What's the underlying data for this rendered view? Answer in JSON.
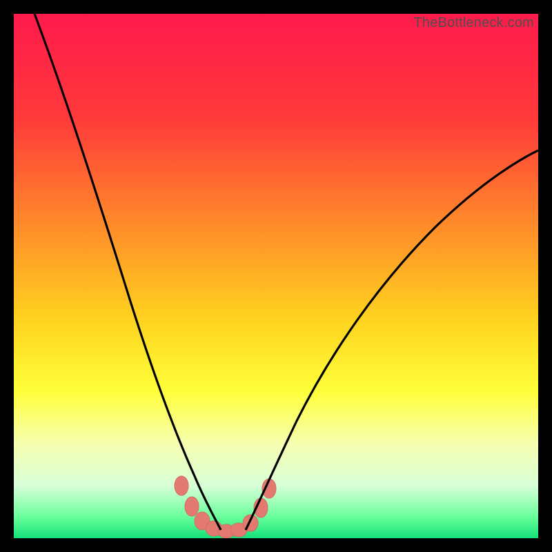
{
  "watermark": "TheBottleneck.com",
  "chart_data": {
    "type": "line",
    "title": "",
    "xlabel": "",
    "ylabel": "",
    "xlim": [
      0,
      100
    ],
    "ylim": [
      0,
      100
    ],
    "series": [
      {
        "name": "left-curve",
        "x": [
          4,
          8,
          12,
          16,
          20,
          24,
          27,
          29,
          31,
          33,
          35,
          37,
          39
        ],
        "y": [
          100,
          90,
          79,
          67,
          54,
          41,
          30,
          23,
          17,
          12,
          8,
          5,
          3
        ]
      },
      {
        "name": "right-curve",
        "x": [
          45,
          48,
          52,
          57,
          63,
          70,
          78,
          87,
          96,
          100
        ],
        "y": [
          3,
          7,
          13,
          22,
          33,
          44,
          54,
          63,
          71,
          74
        ]
      },
      {
        "name": "bottom-band",
        "x": [
          32,
          34,
          36,
          38,
          40,
          42,
          44,
          46,
          48
        ],
        "y": [
          10,
          6,
          3,
          2,
          2,
          2,
          3,
          6,
          10
        ]
      }
    ],
    "gradient_stops": [
      {
        "pos": 0.0,
        "color": "#ff1a4c"
      },
      {
        "pos": 0.2,
        "color": "#ff3a3a"
      },
      {
        "pos": 0.4,
        "color": "#ff8a2a"
      },
      {
        "pos": 0.58,
        "color": "#ffd21f"
      },
      {
        "pos": 0.72,
        "color": "#ffff3a"
      },
      {
        "pos": 0.82,
        "color": "#f6ffb0"
      },
      {
        "pos": 0.9,
        "color": "#d8ffd8"
      },
      {
        "pos": 0.96,
        "color": "#67ff9a"
      },
      {
        "pos": 1.0,
        "color": "#14e07a"
      }
    ],
    "marker_color": "#e37a72",
    "curve_color": "#000000"
  }
}
